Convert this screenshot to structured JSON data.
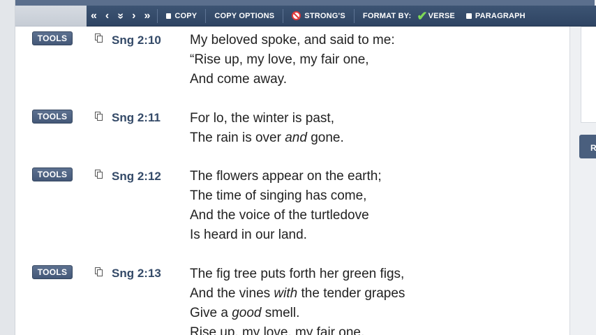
{
  "toolbar": {
    "nav_first": "«",
    "nav_prev": "‹",
    "nav_down": "»",
    "nav_next": "›",
    "nav_last": "»",
    "copy": "COPY",
    "copy_options": "COPY OPTIONS",
    "strongs": "STRONG'S",
    "format_by": "FORMAT BY:",
    "verse": "VERSE",
    "paragraph": "PARAGRAPH"
  },
  "right_tab": "R",
  "verses": [
    {
      "tools": "TOOLS",
      "ref": "Sng 2:10",
      "lines": [
        [
          {
            "t": "My beloved spoke, and said to me:"
          }
        ],
        [
          {
            "t": "“Rise up, my love, my fair one,"
          }
        ],
        [
          {
            "t": "And come away."
          }
        ]
      ]
    },
    {
      "tools": "TOOLS",
      "ref": "Sng 2:11",
      "lines": [
        [
          {
            "t": "For lo, the winter is past,"
          }
        ],
        [
          {
            "t": "The rain is over "
          },
          {
            "t": "and",
            "i": true
          },
          {
            "t": " gone."
          }
        ]
      ]
    },
    {
      "tools": "TOOLS",
      "ref": "Sng 2:12",
      "lines": [
        [
          {
            "t": "The flowers appear on the earth;"
          }
        ],
        [
          {
            "t": "The time of singing has come,"
          }
        ],
        [
          {
            "t": "And the voice of the turtledove"
          }
        ],
        [
          {
            "t": "Is heard in our land."
          }
        ]
      ]
    },
    {
      "tools": "TOOLS",
      "ref": "Sng 2:13",
      "lines": [
        [
          {
            "t": "The fig tree puts forth her green figs,"
          }
        ],
        [
          {
            "t": "And the vines "
          },
          {
            "t": "with",
            "i": true
          },
          {
            "t": " the tender grapes"
          }
        ],
        [
          {
            "t": "Give a "
          },
          {
            "t": "good",
            "i": true
          },
          {
            "t": " smell."
          }
        ],
        [
          {
            "t": "Rise up, my love, my fair one,"
          }
        ]
      ]
    }
  ]
}
